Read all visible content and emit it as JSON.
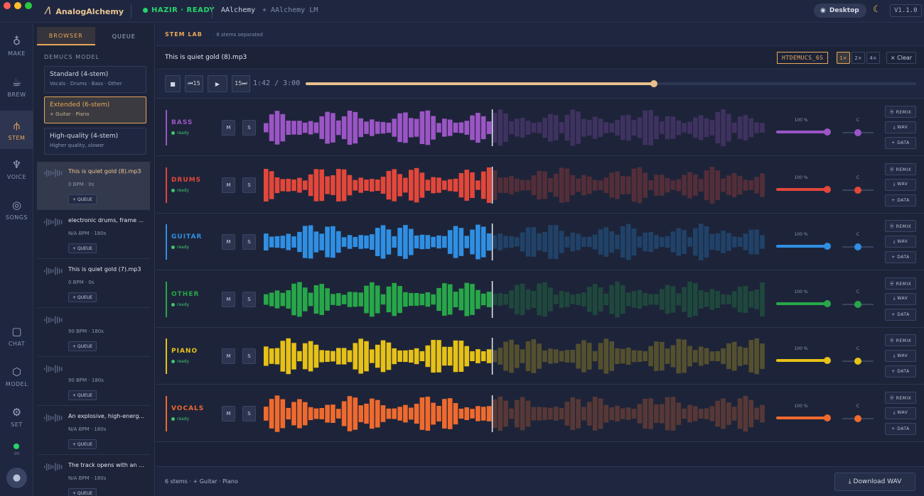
{
  "app": {
    "name": "AnalogAlchemy",
    "status": "HAZIR · READY",
    "app_label": "AAlchemy",
    "lm_label": "+ AAlchemy LM",
    "mode": "Desktop",
    "version": "V1.1.0"
  },
  "nav": {
    "items": [
      {
        "label": "MAKE",
        "icon": "flask-icon"
      },
      {
        "label": "BREW",
        "icon": "cauldron-icon"
      },
      {
        "label": "STEM",
        "icon": "stem-icon",
        "active": true
      },
      {
        "label": "VOICE",
        "icon": "microphone-icon"
      },
      {
        "label": "SONGS",
        "icon": "disc-icon"
      },
      {
        "label": "CHAT",
        "icon": "chat-icon"
      },
      {
        "label": "MODEL",
        "icon": "cube-icon"
      },
      {
        "label": "SET",
        "icon": "gear-icon"
      }
    ],
    "connection": "cn"
  },
  "browser": {
    "tabs": [
      "BROWSER",
      "QUEUE"
    ],
    "model_label": "DEMUCS MODEL",
    "models": [
      {
        "title": "Standard (4-stem)",
        "desc": "Vocals · Drums · Bass · Other"
      },
      {
        "title": "Extended (6-stem)",
        "desc": "+ Guitar · Piano",
        "selected": true
      },
      {
        "title": "High-quality (4-stem)",
        "desc": "Higher quality, slower"
      }
    ],
    "queue_btn": "+ QUEUE",
    "tracks": [
      {
        "title": "This is quiet gold (8).mp3",
        "meta": "0 BPM · 0s",
        "active": true
      },
      {
        "title": "electronic drums, frame ...",
        "meta": "N/A BPM · 180s"
      },
      {
        "title": "This is quiet gold (7).mp3",
        "meta": "0 BPM · 0s"
      },
      {
        "title": "",
        "meta": "90 BPM · 180s"
      },
      {
        "title": "",
        "meta": "90 BPM · 180s"
      },
      {
        "title": "An explosive, high-energ...",
        "meta": "N/A BPM · 180s"
      },
      {
        "title": "The track opens with an ...",
        "meta": "N/A BPM · 180s"
      }
    ]
  },
  "stemlab": {
    "title": "STEM LAB",
    "count": "· 6 stems separated",
    "filename": "This is quiet gold (8).mp3",
    "model_badge": "HTDEMUCS_6S",
    "speeds": [
      "1×",
      "2×",
      "4×"
    ],
    "active_speed": "1×",
    "clear": "× Clear",
    "transport": {
      "stop": "■",
      "back": "⏮15",
      "play": "▶",
      "fwd": "15⏭",
      "time": "1:42 / 3:00",
      "progress": 0.57
    },
    "stems": [
      {
        "name": "BASS",
        "status": "ready",
        "color": "#9b55c5",
        "volume": "100 %",
        "pan": "C"
      },
      {
        "name": "DRUMS",
        "status": "ready",
        "color": "#e2473a",
        "volume": "100 %",
        "pan": "C"
      },
      {
        "name": "GUITAR",
        "status": "ready",
        "color": "#2f8fe3",
        "volume": "100 %",
        "pan": "C"
      },
      {
        "name": "OTHER",
        "status": "ready",
        "color": "#27a749",
        "volume": "100 %",
        "pan": "C"
      },
      {
        "name": "PIANO",
        "status": "ready",
        "color": "#e6c117",
        "volume": "100 %",
        "pan": "C"
      },
      {
        "name": "VOCALS",
        "status": "ready",
        "color": "#ef6a2e",
        "volume": "100 %",
        "pan": "C"
      }
    ],
    "labels": {
      "mute": "M",
      "solo": "S",
      "remix": "⦿ REMIX",
      "wav": "⤓ WAV",
      "data": "+ DATA"
    },
    "footer": "6 stems · + Guitar · Piano",
    "download": "⤓ Download WAV"
  }
}
